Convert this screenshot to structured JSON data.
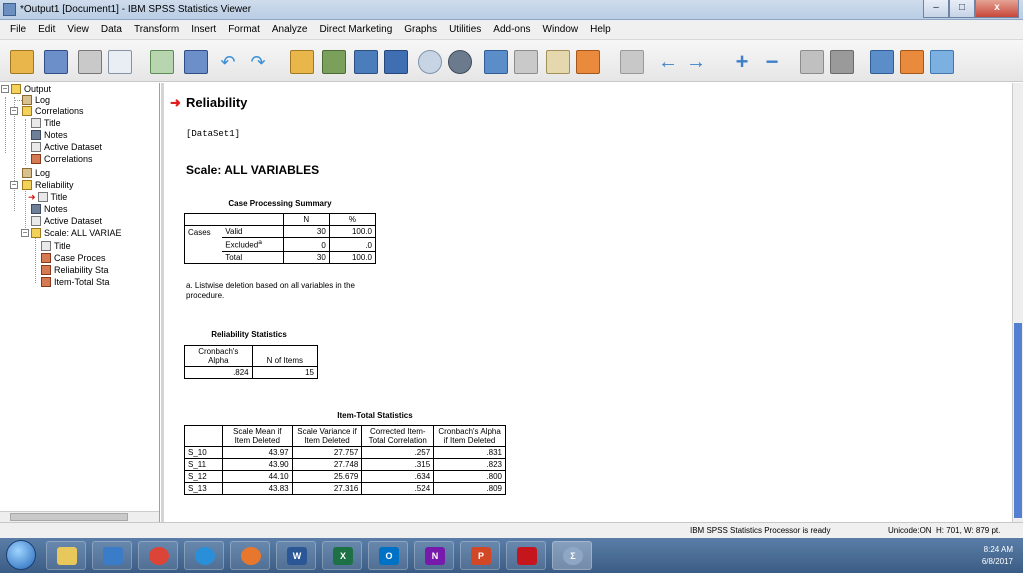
{
  "window": {
    "title": "*Output1 [Document1] - IBM SPSS Statistics Viewer",
    "minimize": "–",
    "maximize": "□",
    "close": "x"
  },
  "menu": [
    "File",
    "Edit",
    "View",
    "Data",
    "Transform",
    "Insert",
    "Format",
    "Analyze",
    "Direct Marketing",
    "Graphs",
    "Utilities",
    "Add-ons",
    "Window",
    "Help"
  ],
  "outline": {
    "items": [
      "Output",
      "Log",
      "Correlations",
      "Title",
      "Notes",
      "Active Dataset",
      "Correlations",
      "Log",
      "Reliability",
      "Title",
      "Notes",
      "Active Dataset",
      "Scale: ALL VARIAE",
      "Title",
      "Case Proces",
      "Reliability Sta",
      "Item-Total Sta"
    ]
  },
  "content": {
    "section_title": "Reliability",
    "dataset": "[DataSet1]",
    "scale_title": "Scale: ALL VARIABLES",
    "case_summary": {
      "caption": "Case Processing Summary",
      "headers": [
        "N",
        "%"
      ],
      "group": "Cases",
      "rows": [
        {
          "label": "Valid",
          "n": "30",
          "pct": "100.0"
        },
        {
          "label": "Excluded",
          "sup": "a",
          "n": "0",
          "pct": ".0"
        },
        {
          "label": "Total",
          "n": "30",
          "pct": "100.0"
        }
      ],
      "footnote": "a. Listwise deletion based on all variables in the procedure."
    },
    "reliability_stats": {
      "caption": "Reliability Statistics",
      "headers": [
        "Cronbach's Alpha",
        "N of Items"
      ],
      "values": [
        ".824",
        "15"
      ]
    },
    "item_total": {
      "caption": "Item-Total Statistics",
      "headers": [
        "Scale Mean if Item Deleted",
        "Scale Variance if Item Deleted",
        "Corrected Item-Total Correlation",
        "Cronbach's Alpha if Item Deleted"
      ],
      "rows": [
        [
          "S_10",
          "43.97",
          "27.757",
          ".257",
          ".831"
        ],
        [
          "S_11",
          "43.90",
          "27.748",
          ".315",
          ".823"
        ],
        [
          "S_12",
          "44.10",
          "25.679",
          ".634",
          ".800"
        ],
        [
          "S_13",
          "43.83",
          "27.316",
          ".524",
          ".809"
        ]
      ]
    }
  },
  "status": {
    "processor": "IBM SPSS Statistics Processor is ready",
    "unicode": "Unicode:ON",
    "dims": "H: 701, W: 879 pt."
  },
  "taskbar": {
    "time": "8:24 AM",
    "date": "6/8/2017",
    "apps": [
      "explorer",
      "media",
      "chrome",
      "ie",
      "firefox",
      "word",
      "excel",
      "outlook",
      "onenote",
      "powerpoint",
      "acrobat",
      "spss"
    ],
    "app_labels": [
      "",
      "",
      "",
      "",
      "",
      "W",
      "X",
      "O",
      "N",
      "P",
      "",
      "Σ"
    ]
  },
  "colors": {
    "accent": "#e02020",
    "scroll_thumb": "#5580d2",
    "taskbar": "#3b5c85"
  }
}
